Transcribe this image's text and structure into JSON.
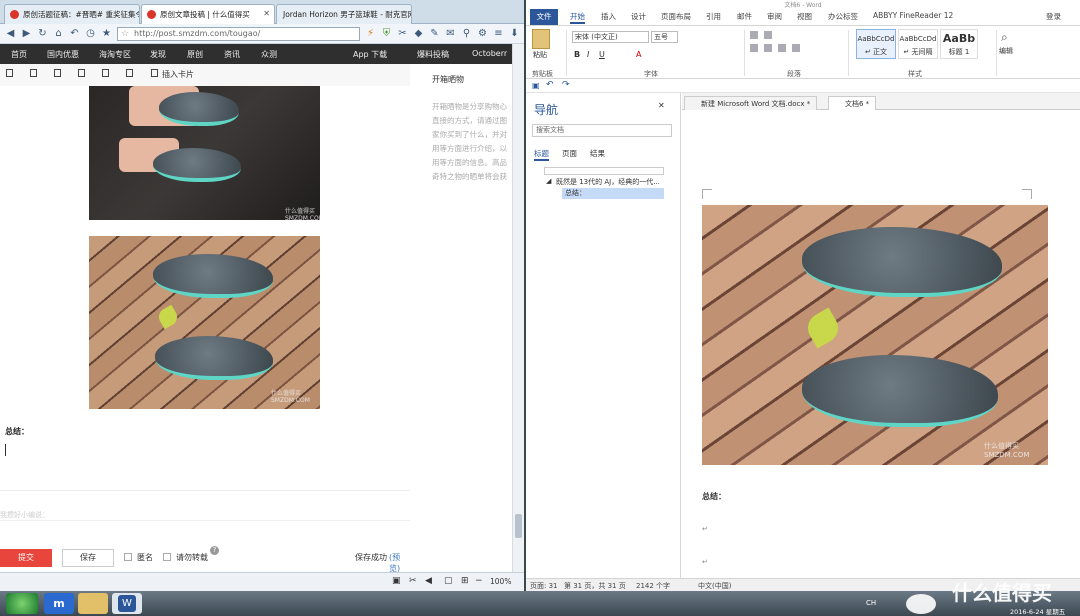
{
  "browser": {
    "tabs": [
      {
        "label": "原创活题征稿：#晋晒# 重奖征集令 ..."
      },
      {
        "label": "原创文章投稿 | 什么值得买"
      },
      {
        "label": "Jordan Horizon 男子篮球鞋 - 耐克官网..."
      }
    ],
    "url": "http://post.smzdm.com/tougao/",
    "menu": [
      "首页",
      "国内优惠",
      "海淘专区",
      "发现",
      "原创",
      "资讯",
      "众测",
      "App 下载",
      "爆料投稿",
      "Octoberr"
    ],
    "insert_card": "插入卡片",
    "summary_label": "总结：",
    "attach_hint": "我攒好小编说：",
    "sidebar": {
      "title": "开箱晒物",
      "lines": [
        "开箱晒物是分享购物心",
        "直接的方式，请通过图",
        "家你买到了什么，并对",
        "用等方面进行介绍，以",
        "用等方面的信息。高品",
        "奇特之物的晒单将会获"
      ]
    },
    "buttons": {
      "submit": "提交",
      "save": "保存"
    },
    "anonymous": "匿名",
    "no_repost": "请勿转载",
    "save_status": "保存成功",
    "save_status_link": "(预览)",
    "zoom": "100%",
    "watermark": "什么值得买 SMZDM.COM"
  },
  "word": {
    "title": "文档6 - Word",
    "file_tab": "文件",
    "tabs": [
      "开始",
      "插入",
      "设计",
      "页面布局",
      "引用",
      "邮件",
      "审阅",
      "视图",
      "办公标签",
      "ABBYY FineReader 12"
    ],
    "user": "登录",
    "font_name": "宋体 (中文正)",
    "font_size": "五号",
    "groups": [
      "剪贴板",
      "字体",
      "段落",
      "样式",
      "编辑"
    ],
    "paste": "粘贴",
    "styles": [
      {
        "preview": "AaBbCcDd",
        "name": "↵ 正文"
      },
      {
        "preview": "AaBbCcDd",
        "name": "↵ 无间隔"
      },
      {
        "preview": "AaBb",
        "name": "标题 1"
      }
    ],
    "edit_label": "编辑",
    "nav": {
      "title": "导航",
      "search_placeholder": "搜索文档",
      "tabs": [
        "标题",
        "页面",
        "结果"
      ],
      "heading1": "既然是 13代的 AJ，经典的一代...",
      "heading2": "总结："
    },
    "doc_tabs": [
      "新建 Microsoft Word 文档.docx *",
      "文档6 *"
    ],
    "doc_summary": "总结：",
    "status": {
      "page": "页面: 31",
      "pages": "第 31 页，共 31 页",
      "words": "2142 个字",
      "lang": "中文(中国)"
    }
  },
  "taskbar": {
    "date": "2016-6-24 星期五",
    "tray_lang": "CH",
    "brand": "什么值得买"
  }
}
